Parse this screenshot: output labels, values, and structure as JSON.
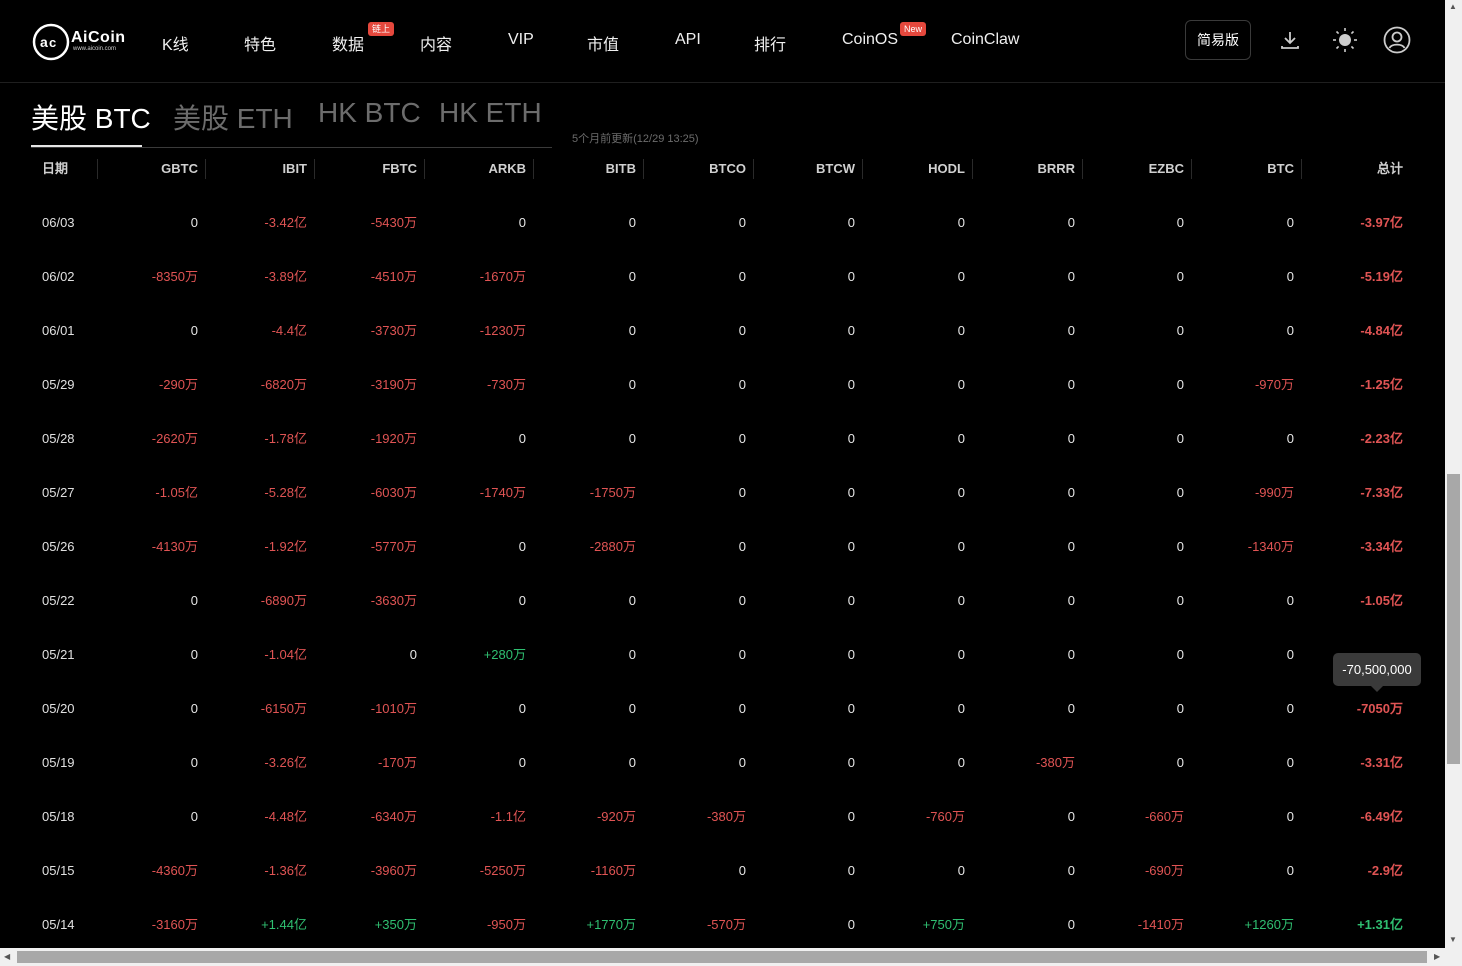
{
  "nav": {
    "logo_text": "AiCoin",
    "logo_url_text": "www.aicoin.com",
    "items": [
      {
        "label": "K线",
        "badge": null
      },
      {
        "label": "特色",
        "badge": null
      },
      {
        "label": "数据",
        "badge": "链上"
      },
      {
        "label": "内容",
        "badge": null
      },
      {
        "label": "VIP",
        "badge": null
      },
      {
        "label": "市值",
        "badge": null
      },
      {
        "label": "API",
        "badge": null
      },
      {
        "label": "排行",
        "badge": null
      },
      {
        "label": "CoinOS",
        "badge": "New"
      },
      {
        "label": "CoinClaw",
        "badge": null
      }
    ],
    "simple_button": "简易版",
    "icons": [
      "download-icon",
      "sun-icon",
      "user-icon"
    ]
  },
  "tabs": [
    "美股 BTC",
    "美股 ETH",
    "HK BTC",
    "HK ETH"
  ],
  "active_tab": 0,
  "update_note": "5个月前更新(12/29 13:25)",
  "table": {
    "headers": [
      "日期",
      "GBTC",
      "IBIT",
      "FBTC",
      "ARKB",
      "BITB",
      "BTCO",
      "BTCW",
      "HODL",
      "BRRR",
      "EZBC",
      "BTC",
      "总计"
    ],
    "rows": [
      [
        "06/03",
        "0",
        "-3.42亿",
        "-5430万",
        "0",
        "0",
        "0",
        "0",
        "0",
        "0",
        "0",
        "0",
        "-3.97亿"
      ],
      [
        "06/02",
        "-8350万",
        "-3.89亿",
        "-4510万",
        "-1670万",
        "0",
        "0",
        "0",
        "0",
        "0",
        "0",
        "0",
        "-5.19亿"
      ],
      [
        "06/01",
        "0",
        "-4.4亿",
        "-3730万",
        "-1230万",
        "0",
        "0",
        "0",
        "0",
        "0",
        "0",
        "0",
        "-4.84亿"
      ],
      [
        "05/29",
        "-290万",
        "-6820万",
        "-3190万",
        "-730万",
        "0",
        "0",
        "0",
        "0",
        "0",
        "0",
        "-970万",
        "-1.25亿"
      ],
      [
        "05/28",
        "-2620万",
        "-1.78亿",
        "-1920万",
        "0",
        "0",
        "0",
        "0",
        "0",
        "0",
        "0",
        "0",
        "-2.23亿"
      ],
      [
        "05/27",
        "-1.05亿",
        "-5.28亿",
        "-6030万",
        "-1740万",
        "-1750万",
        "0",
        "0",
        "0",
        "0",
        "0",
        "-990万",
        "-7.33亿"
      ],
      [
        "05/26",
        "-4130万",
        "-1.92亿",
        "-5770万",
        "0",
        "-2880万",
        "0",
        "0",
        "0",
        "0",
        "0",
        "-1340万",
        "-3.34亿"
      ],
      [
        "05/22",
        "0",
        "-6890万",
        "-3630万",
        "0",
        "0",
        "0",
        "0",
        "0",
        "0",
        "0",
        "0",
        "-1.05亿"
      ],
      [
        "05/21",
        "0",
        "-1.04亿",
        "0",
        "+280万",
        "0",
        "0",
        "0",
        "0",
        "0",
        "0",
        "0",
        ""
      ],
      [
        "05/20",
        "0",
        "-6150万",
        "-1010万",
        "0",
        "0",
        "0",
        "0",
        "0",
        "0",
        "0",
        "0",
        "-7050万"
      ],
      [
        "05/19",
        "0",
        "-3.26亿",
        "-170万",
        "0",
        "0",
        "0",
        "0",
        "0",
        "-380万",
        "0",
        "0",
        "-3.31亿"
      ],
      [
        "05/18",
        "0",
        "-4.48亿",
        "-6340万",
        "-1.1亿",
        "-920万",
        "-380万",
        "0",
        "-760万",
        "0",
        "-660万",
        "0",
        "-6.49亿"
      ],
      [
        "05/15",
        "-4360万",
        "-1.36亿",
        "-3960万",
        "-5250万",
        "-1160万",
        "0",
        "0",
        "0",
        "0",
        "-690万",
        "0",
        "-2.9亿"
      ],
      [
        "05/14",
        "-3160万",
        "+1.44亿",
        "+350万",
        "-950万",
        "+1770万",
        "-570万",
        "0",
        "+750万",
        "0",
        "-1410万",
        "+1260万",
        "+1.31亿"
      ]
    ]
  },
  "tooltip": "-70,500,000",
  "colors": {
    "negative": "#e05454",
    "positive": "#2fbf71",
    "badge": "#e5483d"
  }
}
